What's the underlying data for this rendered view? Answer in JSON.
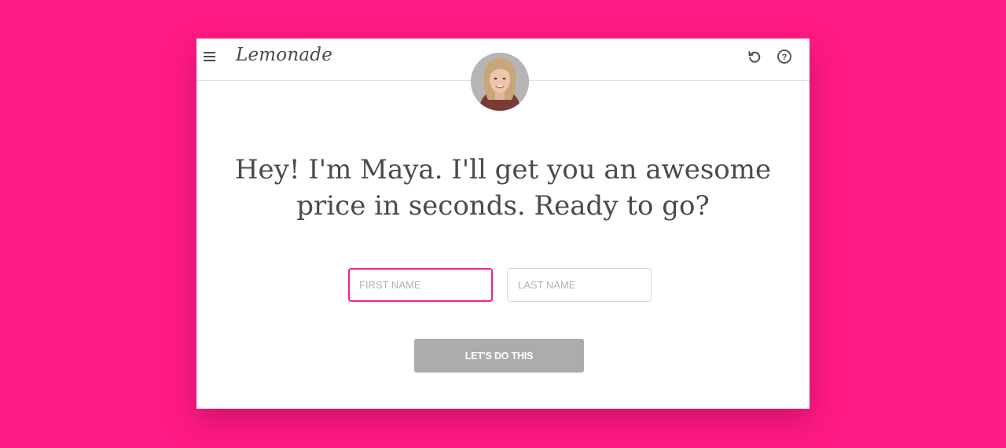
{
  "brand": {
    "logo_text": "Lemonade",
    "accent_color": "#FF1A84"
  },
  "header": {
    "menu_icon": "hamburger-menu-icon",
    "restart_icon": "restart-arrow-icon",
    "help_icon": "help-circle-icon",
    "help_glyph": "?"
  },
  "assistant": {
    "avatar": "maya-avatar"
  },
  "main": {
    "headline_line1": "Hey! I'm Maya. I'll get you an awesome",
    "headline_line2": "price in seconds. Ready to go?"
  },
  "form": {
    "first_name": {
      "placeholder": "FIRST NAME",
      "value": ""
    },
    "last_name": {
      "placeholder": "LAST NAME",
      "value": ""
    },
    "submit_label": "LET'S DO THIS"
  }
}
